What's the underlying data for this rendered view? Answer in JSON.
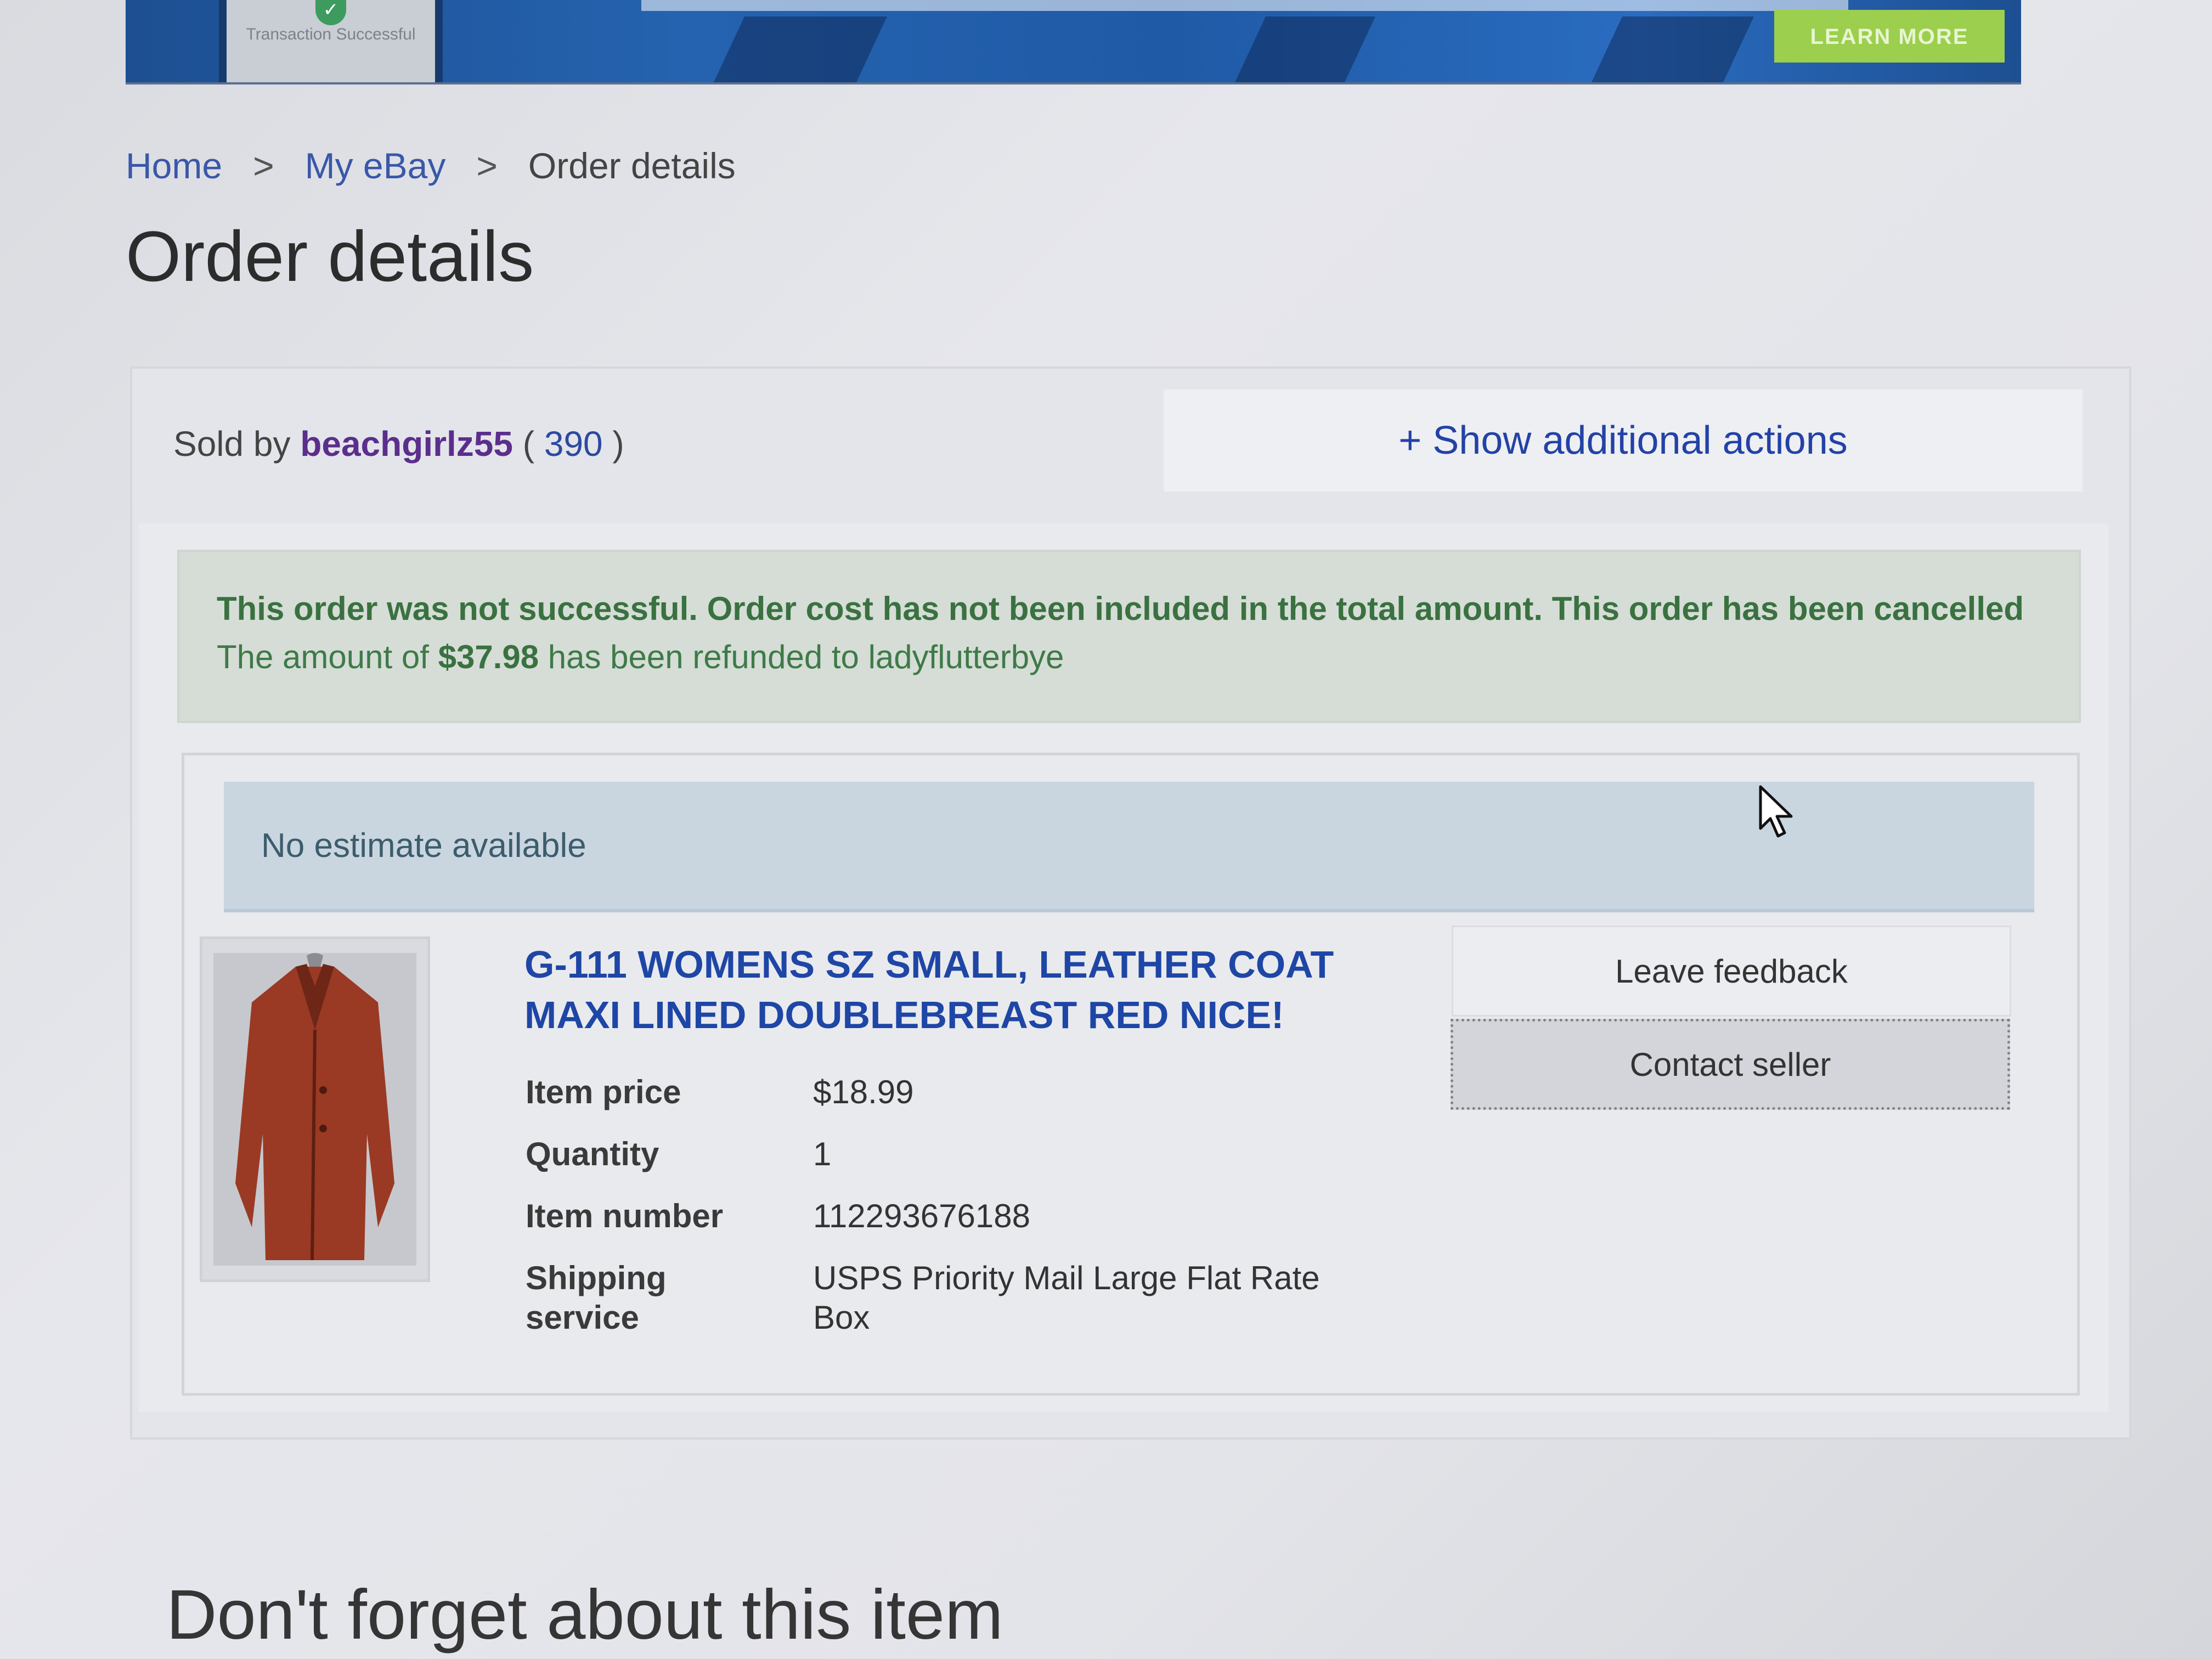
{
  "banner": {
    "badge_text": "Transaction Successful",
    "cta_label": "LEARN MORE"
  },
  "breadcrumb": {
    "items": [
      "Home",
      "My eBay",
      "Order details"
    ],
    "separator": ">"
  },
  "page_title": "Order details",
  "order": {
    "sold_by_label": "Sold by",
    "seller": "beachgirlz55",
    "feedback_score": "390",
    "show_actions_label": "+ Show additional actions",
    "alert": {
      "bold_text": "This order was not successful. Order cost has not been included in the total amount.  This order has been cancelled",
      "refund_prefix": "The amount of",
      "refund_amount": "$37.98",
      "refund_suffix": "has been refunded to ladyflutterbye"
    },
    "estimate_text": "No estimate available",
    "item": {
      "title": "G-111 WOMENS SZ SMALL, LEATHER COAT MAXI LINED DOUBLEBREAST RED NICE!",
      "details": [
        {
          "label": "Item price",
          "value": "$18.99"
        },
        {
          "label": "Quantity",
          "value": "1"
        },
        {
          "label": "Item number",
          "value": "112293676188"
        },
        {
          "label": "Shipping service",
          "value": "USPS Priority Mail Large Flat Rate Box"
        }
      ]
    },
    "buttons": {
      "leave_feedback": "Leave feedback",
      "contact_seller": "Contact seller"
    }
  },
  "section_title": "Don't forget about this item",
  "colors": {
    "link": "#3a57a8",
    "seller": "#5b2e8c",
    "alert_text": "#3e7a48",
    "estimate_bg": "#c9d6e0",
    "item_title": "#1e46a6",
    "banner": "#2563b0",
    "cta": "#9bcf4d"
  }
}
